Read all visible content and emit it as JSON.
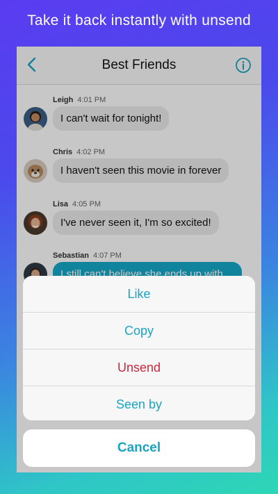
{
  "promo": {
    "headline": "Take it back instantly with unsend"
  },
  "navbar": {
    "title": "Best Friends",
    "back_icon": "chevron-left-icon",
    "info_icon": "info-circle-icon"
  },
  "messages": [
    {
      "sender": "Leigh",
      "time": "4:01 PM",
      "text": "I can't wait for tonight!",
      "style": "received"
    },
    {
      "sender": "Chris",
      "time": "4:02 PM",
      "text": "I haven't seen this movie in forever",
      "style": "received"
    },
    {
      "sender": "Lisa",
      "time": "4:05 PM",
      "text": "I've never seen it, I'm so excited!",
      "style": "received"
    },
    {
      "sender": "Sebastian",
      "time": "4:07 PM",
      "text": "I still can't believe she ends up with",
      "style": "highlighted"
    }
  ],
  "action_sheet": {
    "items": [
      {
        "label": "Like"
      },
      {
        "label": "Copy"
      },
      {
        "label": "Unsend"
      },
      {
        "label": "Seen by"
      }
    ],
    "cancel_label": "Cancel"
  },
  "colors": {
    "accent": "#1aa4c2",
    "destructive": "#c9273c",
    "bubble_highlight": "#16a9c9"
  }
}
